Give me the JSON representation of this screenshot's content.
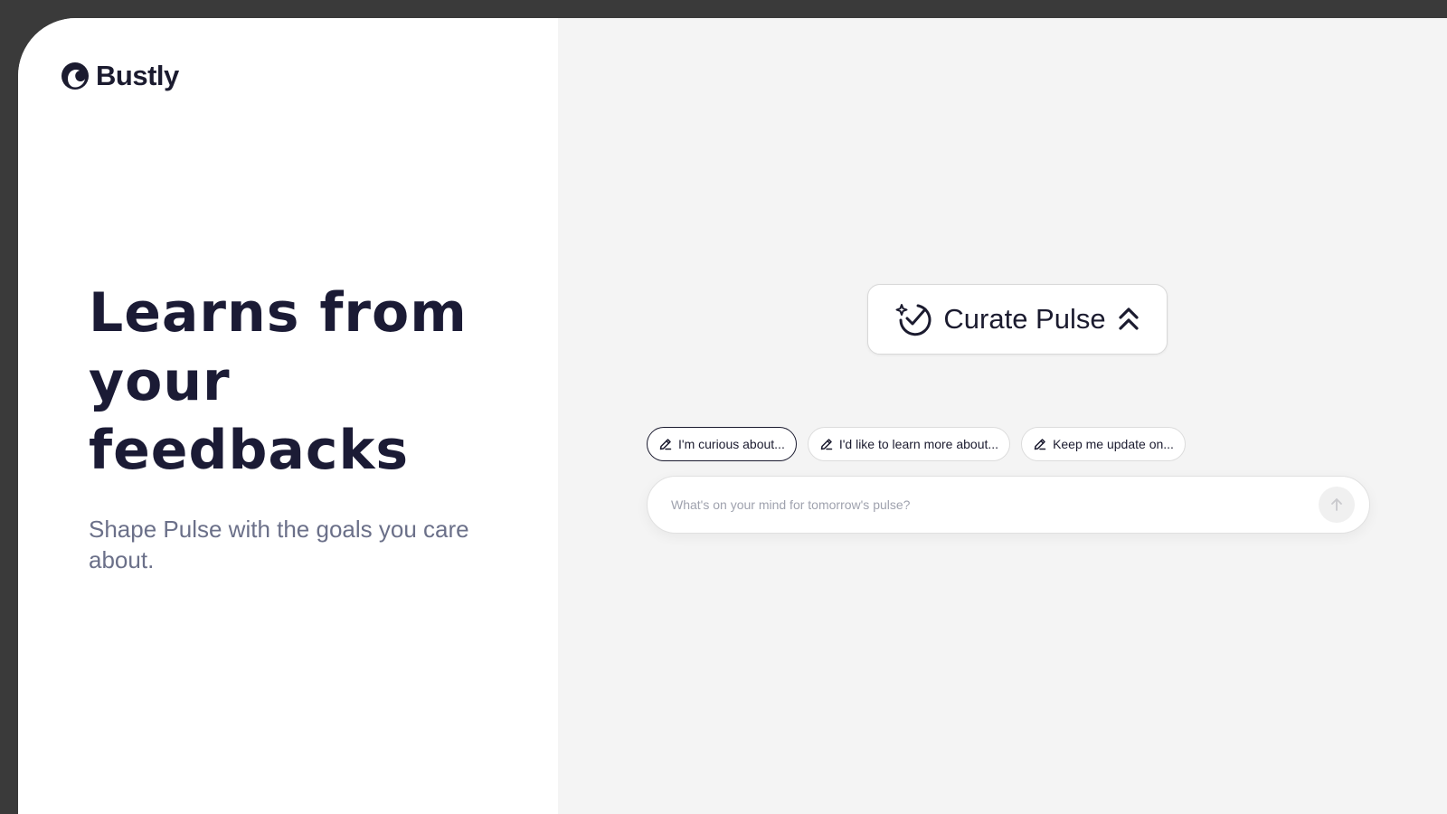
{
  "brand": {
    "name": "Bustly",
    "logo_icon": "globe-swirl-icon"
  },
  "hero": {
    "headline": "Learns from your feedbacks",
    "subtitle": "Shape Pulse with the goals you care about."
  },
  "curate": {
    "label": "Curate Pulse",
    "icon": "sparkle-check-icon",
    "toggle_icon": "double-chevron-up-icon"
  },
  "suggestions": [
    {
      "label": "I'm curious about...",
      "icon": "pencil-icon",
      "active": true
    },
    {
      "label": "I'd like to learn more about...",
      "icon": "pencil-icon",
      "active": false
    },
    {
      "label": "Keep me update on...",
      "icon": "pencil-icon",
      "active": false
    }
  ],
  "composer": {
    "placeholder": "What's on your mind for tomorrow's pulse?",
    "value": "",
    "send_icon": "arrow-up-icon"
  },
  "colors": {
    "background_dark": "#3a3a3a",
    "panel_left": "#ffffff",
    "panel_right": "#f4f4f4",
    "text_primary": "#1b1b2f",
    "text_secondary": "#6b7089"
  }
}
